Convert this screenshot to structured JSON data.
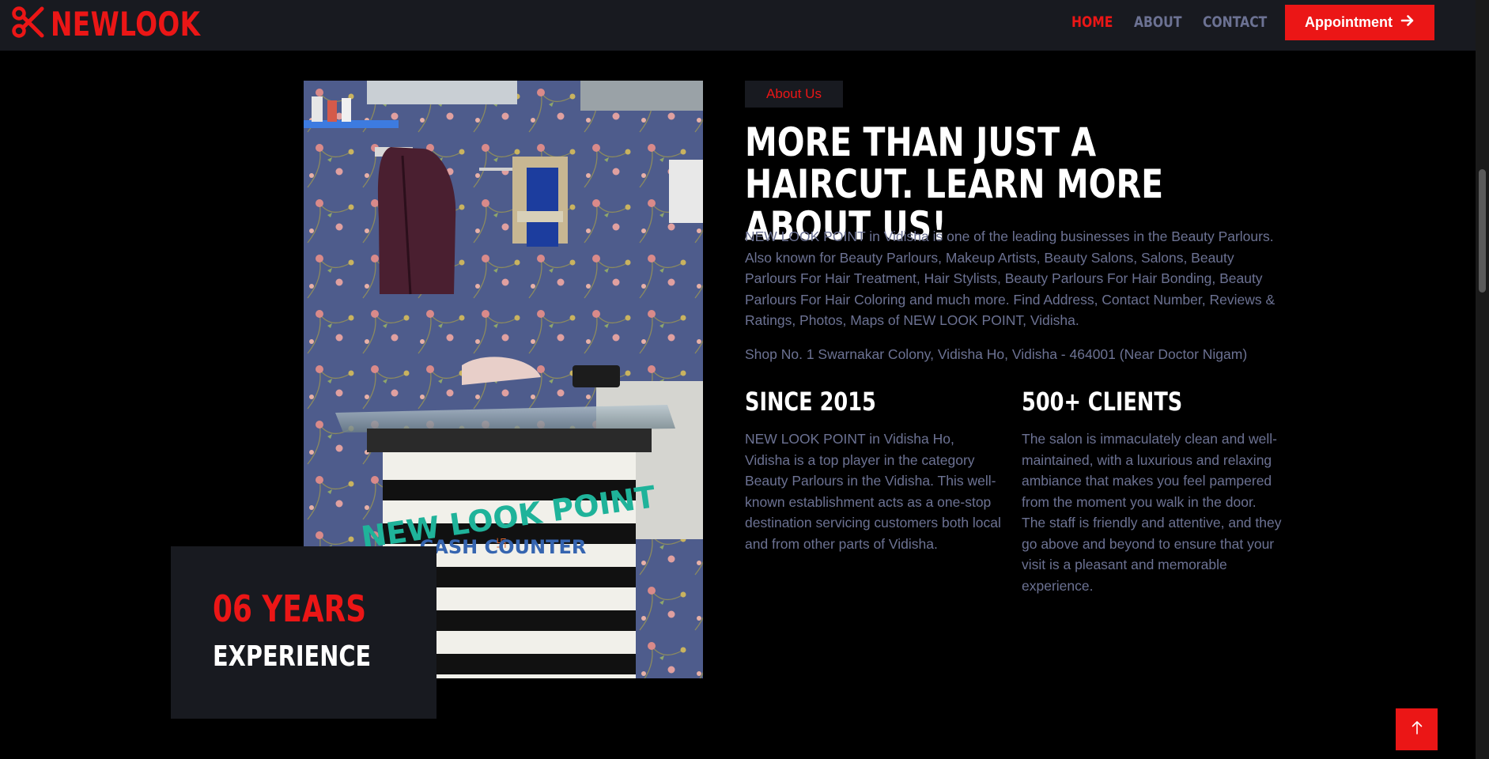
{
  "brand": {
    "name": "NEWLOOK",
    "icon": "scissors-icon"
  },
  "nav": {
    "items": [
      {
        "label": "HOME",
        "active": true
      },
      {
        "label": "ABOUT",
        "active": false
      },
      {
        "label": "CONTACT",
        "active": false
      }
    ],
    "cta_label": "Appointment",
    "cta_icon": "arrow-right-icon"
  },
  "about": {
    "badge": "About Us",
    "heading": "MORE THAN JUST A HAIRCUT. LEARN MORE ABOUT US!",
    "paragraph": "NEW LOOK POINT in Vidisha is one of the leading businesses in the Beauty Parlours. Also known for Beauty Parlours, Makeup Artists, Beauty Salons, Salons, Beauty Parlours For Hair Treatment, Hair Stylists, Beauty Parlours For Hair Bonding, Beauty Parlours For Hair Coloring and much more. Find Address, Contact Number, Reviews & Ratings, Photos, Maps of NEW LOOK POINT, Vidisha.",
    "address": "Shop No. 1 Swarnakar Colony, Vidisha Ho, Vidisha - 464001 (Near Doctor Nigam)",
    "stats": [
      {
        "title": "SINCE 2015",
        "text": "NEW LOOK POINT in Vidisha Ho, Vidisha is a top player in the category Beauty Parlours in the Vidisha. This well-known establishment acts as a one-stop destination servicing customers both local and from other parts of Vidisha."
      },
      {
        "title": "500+ CLIENTS",
        "text": "The salon is immaculately clean and well-maintained, with a luxurious and relaxing ambiance that makes you feel pampered from the moment you walk in the door. The staff is friendly and attentive, and they go above and beyond to ensure that your visit is a pleasant and memorable experience."
      }
    ]
  },
  "photo": {
    "sign_line1": "NEW LOOK POINT",
    "sign_line2": "CASH COUNTER"
  },
  "experience": {
    "years": "06 YEARS",
    "label": "EXPERIENCE"
  },
  "back_to_top_icon": "arrow-up-icon",
  "colors": {
    "accent": "#eb1616",
    "panel": "#181a20",
    "muted_text": "#6c7293",
    "background": "#000000"
  }
}
